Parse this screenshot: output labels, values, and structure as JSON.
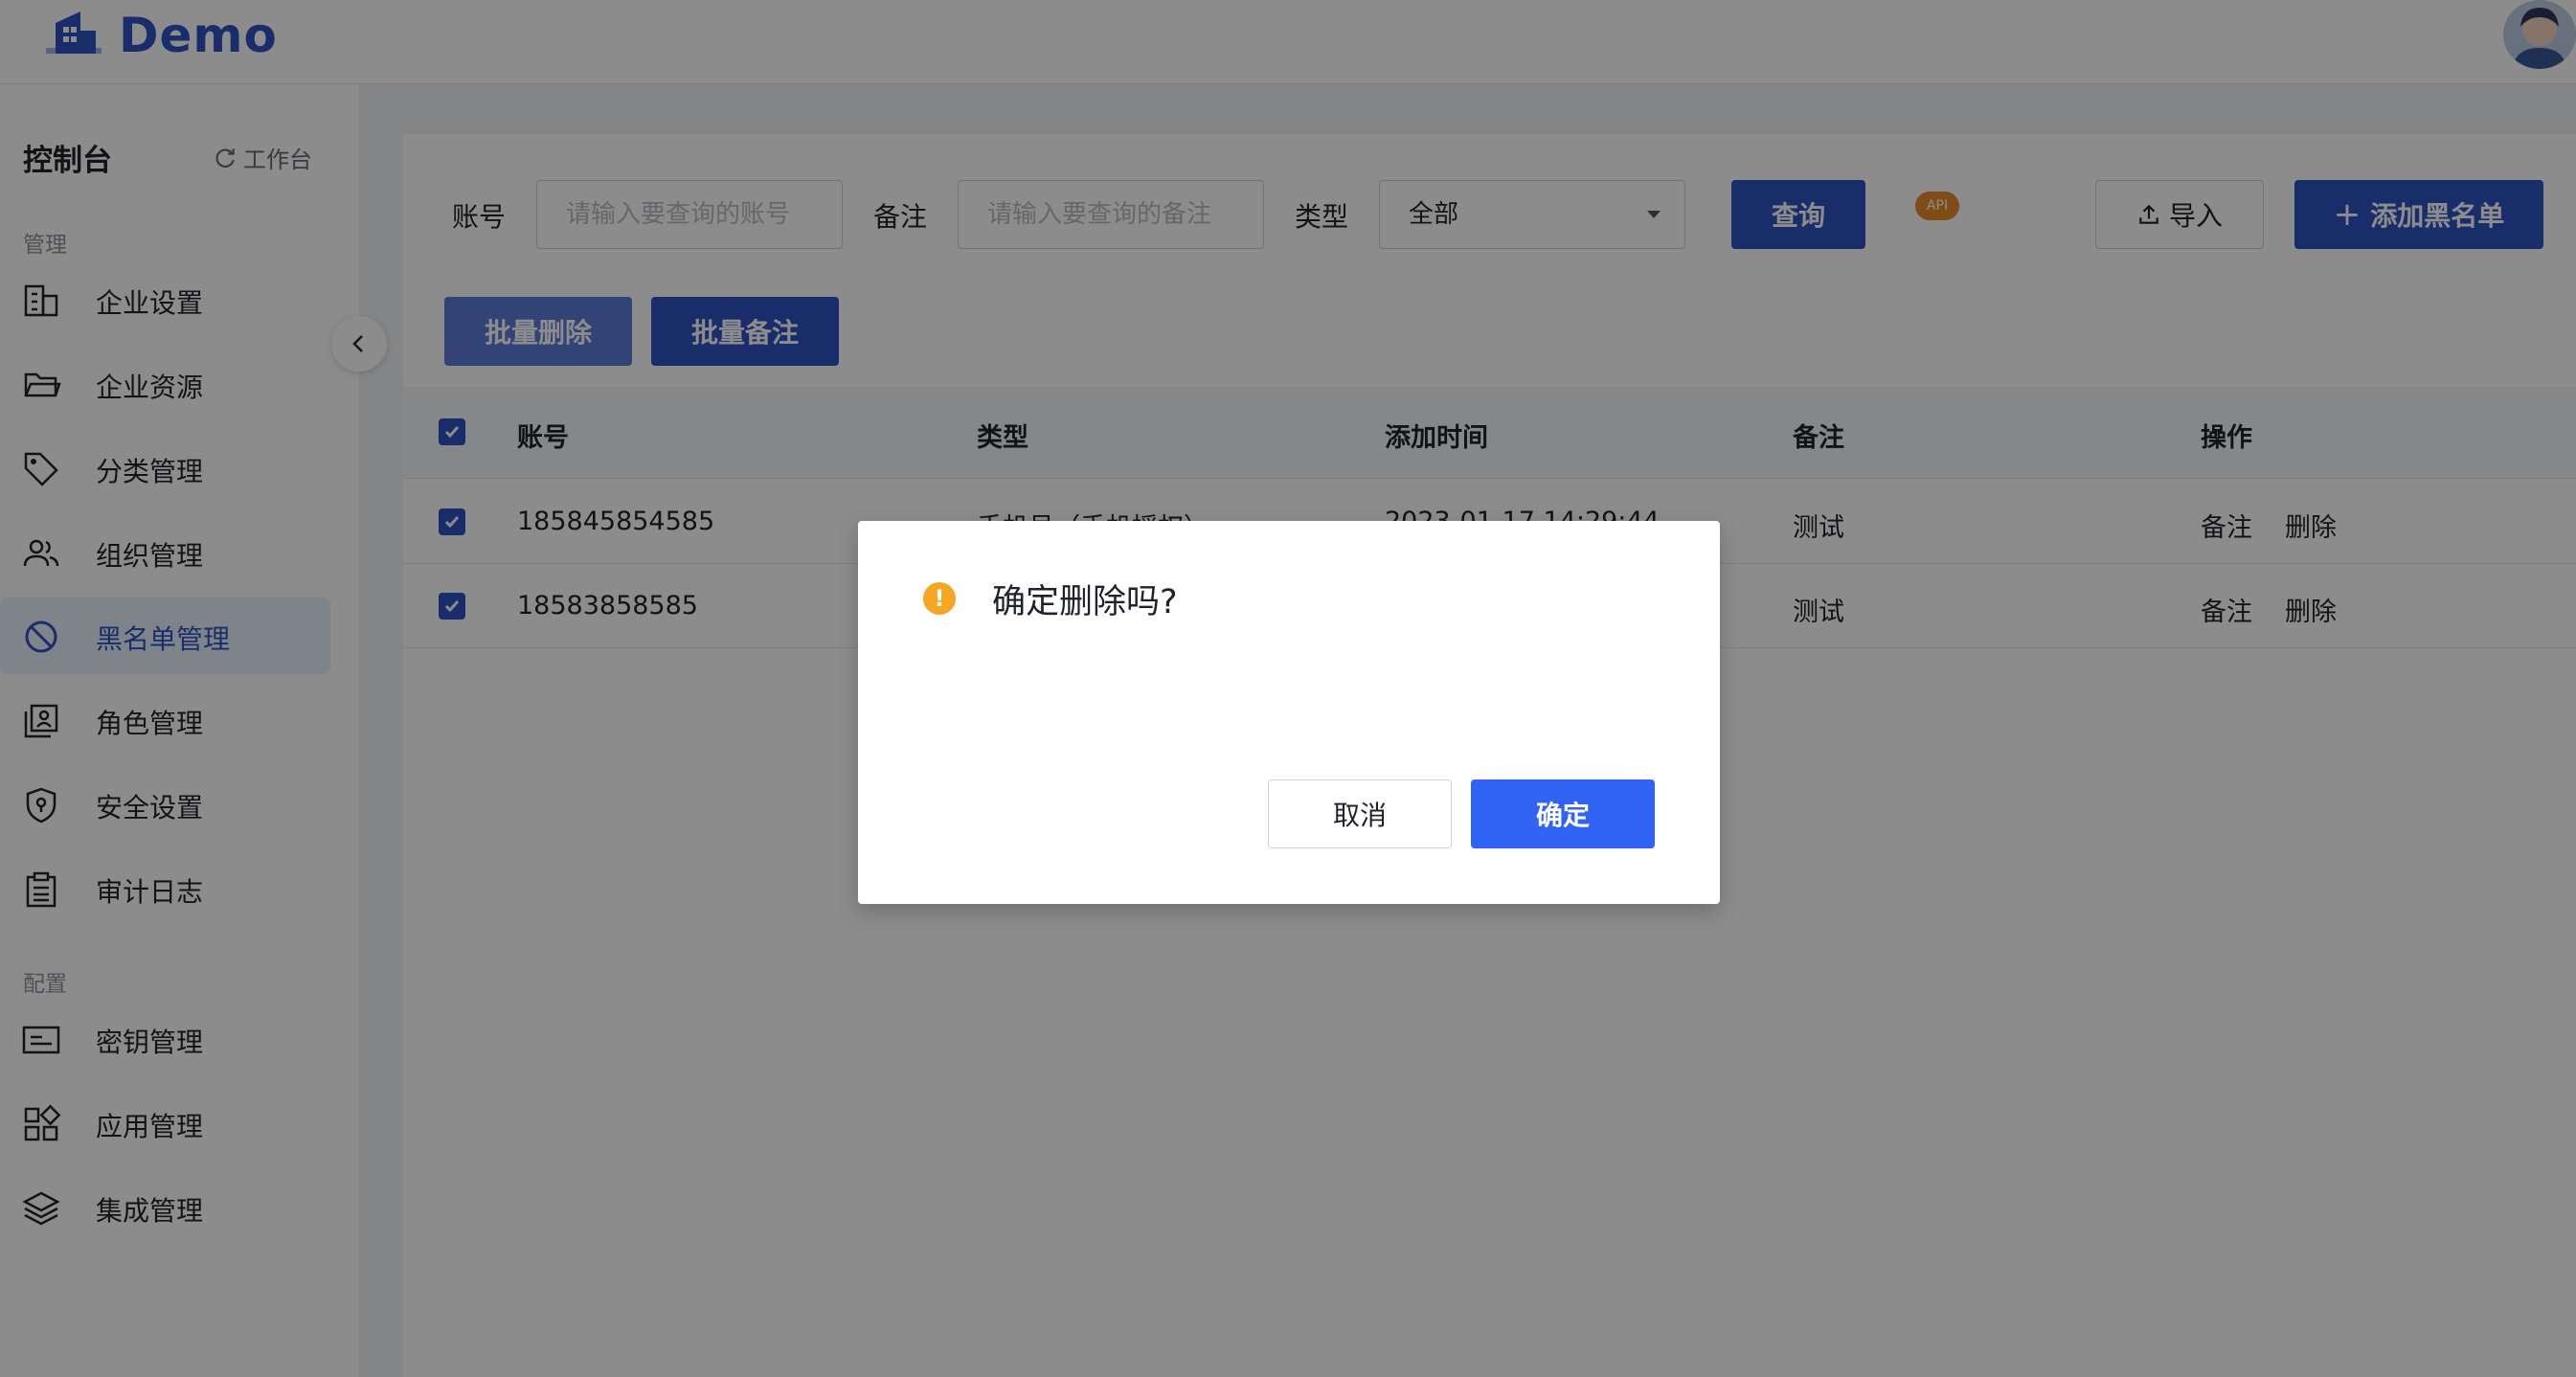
{
  "header": {
    "logo_text": "Demo",
    "avatar_icon": "user-avatar"
  },
  "sidebar": {
    "title": "控制台",
    "workbench_label": "工作台",
    "groups": [
      {
        "label": "管理"
      },
      {
        "label": "配置"
      }
    ],
    "items": [
      {
        "label": "企业设置",
        "icon": "building-icon"
      },
      {
        "label": "企业资源",
        "icon": "folder-icon"
      },
      {
        "label": "分类管理",
        "icon": "tag-icon"
      },
      {
        "label": "组织管理",
        "icon": "users-icon"
      },
      {
        "label": "黑名单管理",
        "icon": "ban-icon",
        "active": true
      },
      {
        "label": "角色管理",
        "icon": "role-icon"
      },
      {
        "label": "安全设置",
        "icon": "shield-icon"
      },
      {
        "label": "审计日志",
        "icon": "clipboard-icon"
      },
      {
        "label": "密钥管理",
        "icon": "key-card-icon"
      },
      {
        "label": "应用管理",
        "icon": "apps-icon"
      },
      {
        "label": "集成管理",
        "icon": "layers-icon"
      }
    ]
  },
  "filters": {
    "account_label": "账号",
    "account_placeholder": "请输入要查询的账号",
    "note_label": "备注",
    "note_placeholder": "请输入要查询的备注",
    "type_label": "类型",
    "type_value": "全部",
    "query_button": "查询",
    "api_badge": "API",
    "import_button": "导入",
    "add_button": "添加黑名单"
  },
  "batch": {
    "delete_button": "批量删除",
    "note_button": "批量备注"
  },
  "table": {
    "columns": [
      "账号",
      "类型",
      "添加时间",
      "备注",
      "操作"
    ],
    "rows": [
      {
        "account": "185845854585",
        "type": "手机号（手机授权）",
        "time": "2023-01-17 14:29:44",
        "note": "测试",
        "actions": [
          "备注",
          "删除"
        ],
        "checked": true
      },
      {
        "account": "18583858585",
        "type": "",
        "time": "",
        "note": "测试",
        "actions": [
          "备注",
          "删除"
        ],
        "checked": true
      }
    ]
  },
  "modal": {
    "title": "确定删除吗?",
    "cancel_button": "取消",
    "ok_button": "确定"
  },
  "colors": {
    "primary": "#2f52c4",
    "modal_ok": "#3164f5",
    "warning": "#f5a623"
  }
}
